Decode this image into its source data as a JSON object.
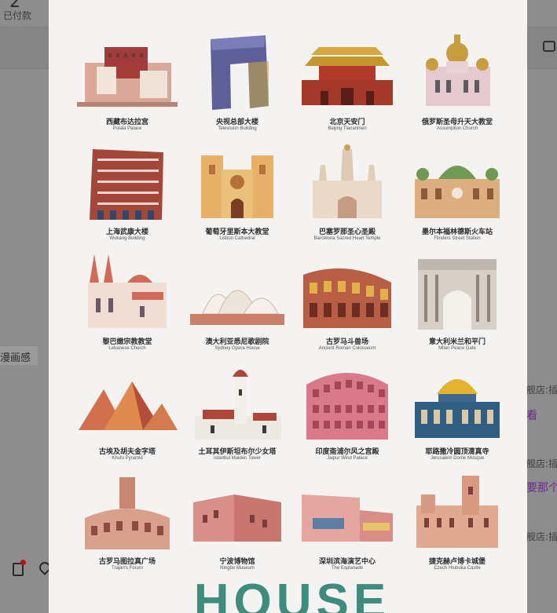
{
  "background": {
    "paid_count": "2",
    "paid_label": "已付款",
    "left_chip_label": "漫画感",
    "right_messages": [
      "舰店:插",
      "看",
      "舰店:插",
      "要那个",
      "舰店:插"
    ]
  },
  "poster": {
    "footer_word": "HOUSE",
    "landmarks": [
      {
        "cn": "西藏布达拉宫",
        "en": "Potala Palace"
      },
      {
        "cn": "央视总部大楼",
        "en": "Television Building"
      },
      {
        "cn": "北京天安门",
        "en": "Beijing Tiananmen"
      },
      {
        "cn": "俄罗斯圣母升天大教堂",
        "en": "Assumption Church"
      },
      {
        "cn": "上海武康大楼",
        "en": "Wukang Building"
      },
      {
        "cn": "葡萄牙里斯本大教堂",
        "en": "Lisbon Cathedral"
      },
      {
        "cn": "巴塞罗那圣心圣殿",
        "en": "Barcelona Sacred Heart Temple"
      },
      {
        "cn": "墨尔本福林德斯火车站",
        "en": "Flinders Street Station"
      },
      {
        "cn": "黎巴嫩宗教教堂",
        "en": "Lebanese Church"
      },
      {
        "cn": "澳大利亚悉尼歌剧院",
        "en": "Sydney Opera House"
      },
      {
        "cn": "古罗马斗兽场",
        "en": "Ancient Roman Colosseum"
      },
      {
        "cn": "意大利米兰和平门",
        "en": "Milan Peace Gate"
      },
      {
        "cn": "古埃及胡夫金字塔",
        "en": "Khufu Pyramid"
      },
      {
        "cn": "土耳其伊斯坦布尔少女塔",
        "en": "Istanbul Maiden Tower"
      },
      {
        "cn": "印度斋浦尔风之宫殿",
        "en": "Jaipur Wind Palace"
      },
      {
        "cn": "耶路撒冷圆顶清真寺",
        "en": "Jerusalem Dome Mosque"
      },
      {
        "cn": "古罗马图拉真广场",
        "en": "Trajan's Forum"
      },
      {
        "cn": "宁波博物馆",
        "en": "Ningbo Museum"
      },
      {
        "cn": "深圳滨海演艺中心",
        "en": "The Esplanade"
      },
      {
        "cn": "捷克赫卢博卡城堡",
        "en": "Czech Hluboka Castle"
      }
    ]
  },
  "icons": {
    "doc": "document-icon",
    "location": "location-icon",
    "video": "video-call-icon"
  },
  "colors": {
    "poster_bg": "#f4f3f1",
    "house_text": "#3f8c7f",
    "link_purple": "#6c2a8e",
    "badge_red": "#b8121a"
  }
}
